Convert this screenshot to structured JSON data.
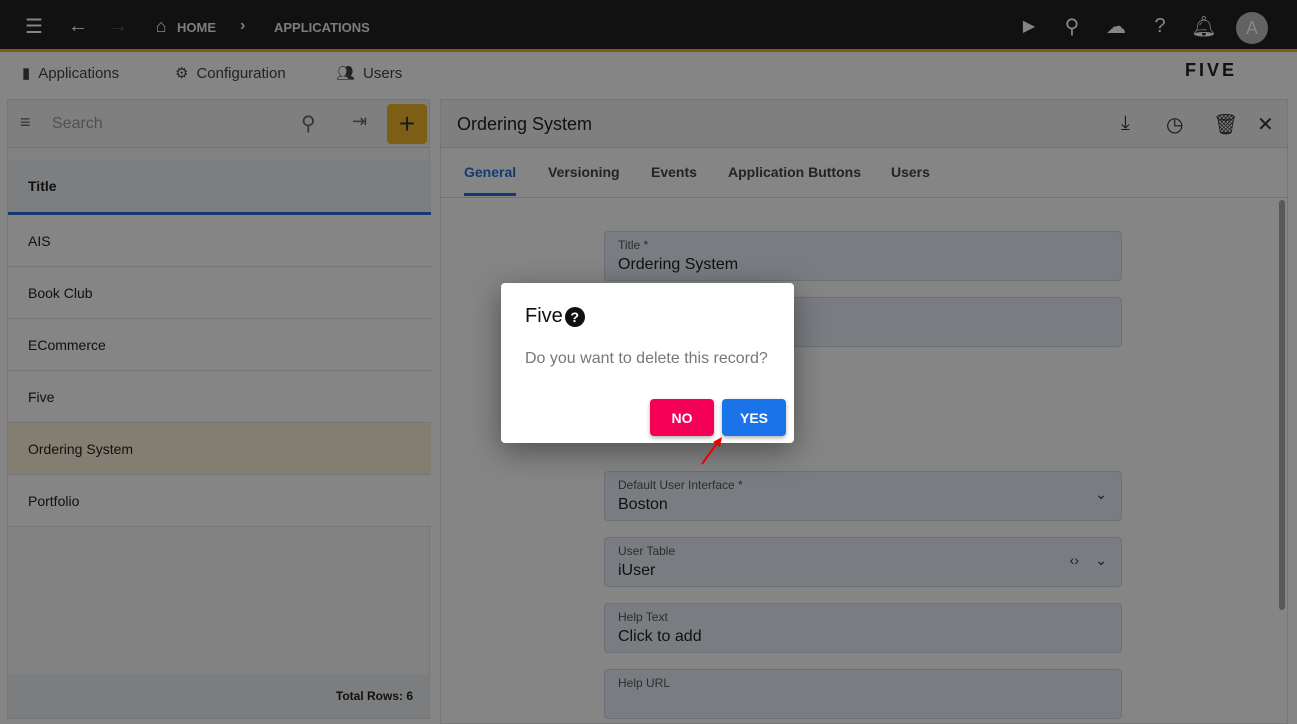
{
  "topbar": {
    "home": "HOME",
    "separator": "›",
    "current": "APPLICATIONS",
    "avatar": "A"
  },
  "nav": {
    "items": [
      {
        "label": "Applications",
        "icon": "application-icon"
      },
      {
        "label": "Configuration",
        "icon": "gear-wrench-icon"
      },
      {
        "label": "Users",
        "icon": "users-icon"
      }
    ],
    "logo": "FIVE"
  },
  "list": {
    "search_placeholder": "Search",
    "column": "Title",
    "rows": [
      "AIS",
      "Book Club",
      "ECommerce",
      "Five",
      "Ordering System",
      "Portfolio"
    ],
    "selected": "Ordering System",
    "total": "Total Rows: 6"
  },
  "detail": {
    "title": "Ordering System",
    "tabs": [
      "General",
      "Versioning",
      "Events",
      "Application Buttons",
      "Users"
    ],
    "active_tab": "General",
    "fields": [
      {
        "label": "Title *",
        "value": "Ordering System"
      },
      {
        "label": "Default User Interface *",
        "value": "Boston"
      },
      {
        "label": "User Table",
        "value": "iUser"
      },
      {
        "label": "Help Text",
        "value": "Click to add"
      },
      {
        "label": "Help URL",
        "value": ""
      }
    ]
  },
  "dialog": {
    "title": "Five",
    "message": "Do you want to delete this record?",
    "no": "NO",
    "yes": "YES"
  },
  "colors": {
    "accent": "#f0b429",
    "primary": "#1a73e8",
    "danger": "#f50057"
  }
}
